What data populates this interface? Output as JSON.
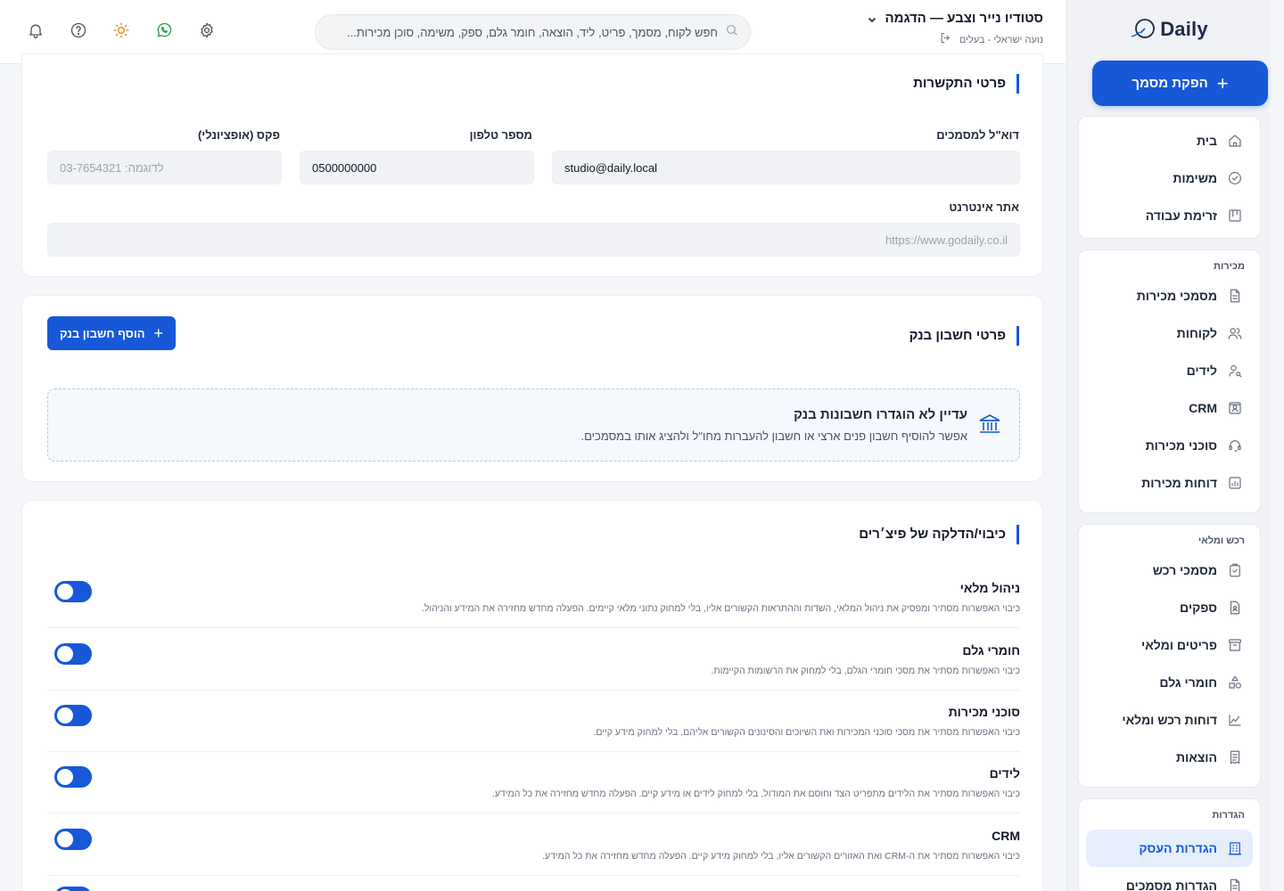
{
  "header": {
    "business_name": "סטודיו נייר וצבע — הדגמה",
    "user_name": "נועה ישראלי - בעלים",
    "search_placeholder": "חפש לקוח, מסמך, פריט, ליד, הוצאה, חומר גלם, ספק, משימה, סוכן מכירות..."
  },
  "sidebar": {
    "logo_text": "Daily",
    "create_label": "הפקת מסמך",
    "main_items": [
      {
        "label": "בית",
        "icon": "home-icon"
      },
      {
        "label": "משימות",
        "icon": "check-circle-icon"
      },
      {
        "label": "זרימת עבודה",
        "icon": "kanban-icon"
      }
    ],
    "sales_title": "מכירות",
    "sales_items": [
      {
        "label": "מסמכי מכירות",
        "icon": "document-icon"
      },
      {
        "label": "לקוחות",
        "icon": "users-icon"
      },
      {
        "label": "לידים",
        "icon": "user-search-icon"
      },
      {
        "label": "CRM",
        "icon": "contact-card-icon"
      },
      {
        "label": "סוכני מכירות",
        "icon": "headset-icon"
      },
      {
        "label": "דוחות מכירות",
        "icon": "report-chart-icon"
      }
    ],
    "purchase_title": "רכש ומלאי",
    "purchase_items": [
      {
        "label": "מסמכי רכש",
        "icon": "clipboard-check-icon"
      },
      {
        "label": "ספקים",
        "icon": "supplier-file-icon"
      },
      {
        "label": "פריטים ומלאי",
        "icon": "archive-box-icon"
      },
      {
        "label": "חומרי גלם",
        "icon": "shapes-icon"
      },
      {
        "label": "דוחות רכש ומלאי",
        "icon": "line-chart-icon"
      },
      {
        "label": "הוצאות",
        "icon": "receipt-icon"
      }
    ],
    "settings_title": "הגדרות",
    "settings_items": [
      {
        "label": "הגדרות העסק",
        "icon": "building-icon",
        "active": true
      },
      {
        "label": "הגדרות מסמכים",
        "icon": "document-settings-icon"
      }
    ]
  },
  "contact": {
    "title": "פרטי התקשרות",
    "email_label": "דוא\"ל למסמכים",
    "email_value": "studio@daily.local",
    "phone_label": "מספר טלפון",
    "phone_value": "0500000000",
    "fax_label": "פקס (אופציונלי)",
    "fax_placeholder": "לדוגמה: 03-7654321",
    "website_label": "אתר אינטרנט",
    "website_placeholder": "https://www.godaily.co.il"
  },
  "bank": {
    "title": "פרטי חשבון בנק",
    "add_label": "הוסף חשבון בנק",
    "empty_title": "עדיין לא הוגדרו חשבונות בנק",
    "empty_desc": "אפשר להוסיף חשבון פנים ארצי או חשבון להעברות מחו\"ל ולהציג אותו במסמכים."
  },
  "features": {
    "title": "כיבוי/הדלקה של פיצ׳רים",
    "items": [
      {
        "name": "ניהול מלאי",
        "desc": "כיבוי האפשרות מסתיר ומפסיק את ניהול המלאי, השדות וההתראות הקשורים אליו, בלי למחוק נתוני מלאי קיימים. הפעלה מחדש מחזירה את המידע והניהול.",
        "enabled": true
      },
      {
        "name": "חומרי גלם",
        "desc": "כיבוי האפשרות מסתיר את מסכי חומרי הגלם, בלי למחוק את הרשומות הקיימות.",
        "enabled": true
      },
      {
        "name": "סוכני מכירות",
        "desc": "כיבוי האפשרות מסתיר את מסכי סוכני המכירות ואת השיוכים והסינונים הקשורים אליהם, בלי למחוק מידע קיים.",
        "enabled": true
      },
      {
        "name": "לידים",
        "desc": "כיבוי האפשרות מסתיר את הלידים מתפריט הצד וחוסם את המודול, בלי למחוק לידים או מידע קיים. הפעלה מחדש מחזירה את כל המידע.",
        "enabled": true
      },
      {
        "name": "CRM",
        "desc": "כיבוי האפשרות מסתיר את ה-CRM ואת האזורים הקשורים אליו, בלי למחוק מידע קיים. הפעלה מחדש מחזירה את כל המידע.",
        "enabled": true
      }
    ]
  },
  "colors": {
    "accent": "#1658d8",
    "whatsapp": "#25a244",
    "sun": "#e08a00"
  }
}
